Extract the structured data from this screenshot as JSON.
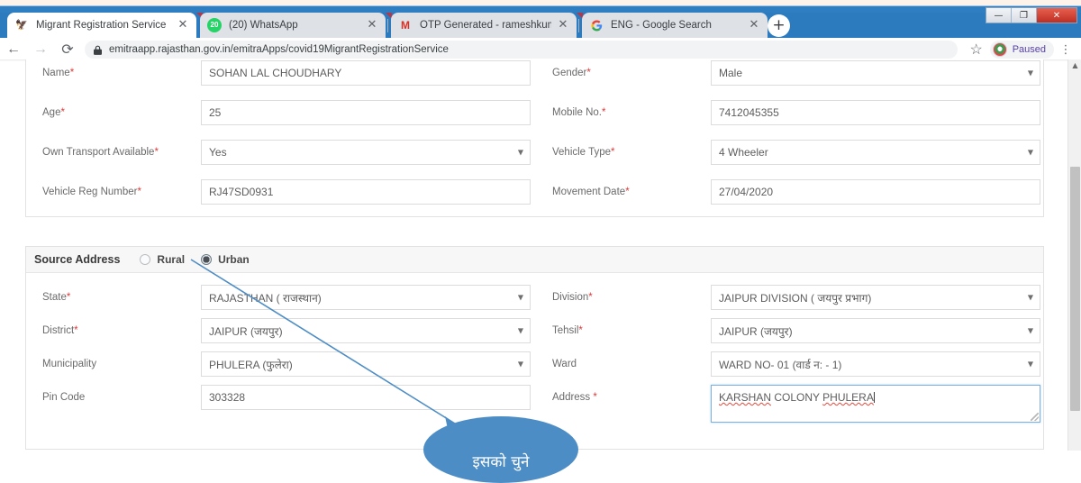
{
  "window": {
    "controls": [
      {
        "name": "minimize",
        "glyph": "—"
      },
      {
        "name": "maximize",
        "glyph": "❐"
      },
      {
        "name": "close",
        "glyph": "✕"
      }
    ]
  },
  "browser": {
    "tabs": [
      {
        "title": "Migrant Registration Service",
        "favicon": "site-favicon",
        "favicon_glyph": "🦅",
        "active": true,
        "close_glyph": "✕"
      },
      {
        "title": "(20) WhatsApp",
        "favicon": "whatsapp-favicon",
        "favicon_glyph": "20",
        "active": false,
        "close_glyph": "✕"
      },
      {
        "title": "OTP Generated - rameshkumawa",
        "favicon": "gmail-favicon",
        "favicon_glyph": "M",
        "active": false,
        "close_glyph": "✕"
      },
      {
        "title": "ENG - Google Search",
        "favicon": "google-favicon",
        "favicon_glyph": "G",
        "active": false,
        "close_glyph": "✕"
      }
    ],
    "new_tab_glyph": "+",
    "nav": {
      "back_glyph": "←",
      "forward_glyph": "→",
      "reload_glyph": "⟳"
    },
    "omnibox": {
      "url": "emitraapp.rajasthan.gov.in/emitraApps/covid19MigrantRegistrationService",
      "lock_icon": "lock-icon"
    },
    "bookmark_glyph": "☆",
    "profile": {
      "label": "Paused"
    },
    "menu_glyph": "⋮"
  },
  "page": {
    "personal_panel": {
      "rows": [
        {
          "left": {
            "label": "Name",
            "required": true,
            "type": "text",
            "value": "SOHAN LAL CHOUDHARY"
          },
          "right": {
            "label": "Gender",
            "required": true,
            "type": "select",
            "value": "Male"
          }
        },
        {
          "left": {
            "label": "Age",
            "required": true,
            "type": "text",
            "value": "25"
          },
          "right": {
            "label": "Mobile No.",
            "required": true,
            "type": "text",
            "value": "7412045355"
          }
        },
        {
          "left": {
            "label": "Own Transport Available",
            "required": true,
            "type": "select",
            "value": "Yes"
          },
          "right": {
            "label": "Vehicle Type",
            "required": true,
            "type": "select",
            "value": "4 Wheeler"
          }
        },
        {
          "left": {
            "label": "Vehicle Reg Number",
            "required": true,
            "type": "text",
            "value": "RJ47SD0931"
          },
          "right": {
            "label": "Movement Date",
            "required": true,
            "type": "text",
            "value": "27/04/2020"
          }
        }
      ]
    },
    "source_panel": {
      "title": "Source Address",
      "radios": [
        {
          "label": "Rural",
          "checked": false
        },
        {
          "label": "Urban",
          "checked": true
        }
      ],
      "rows": [
        {
          "left": {
            "label": "State",
            "required": true,
            "type": "select",
            "value": "RAJASTHAN ( राजस्थान)"
          },
          "right": {
            "label": "Division",
            "required": true,
            "type": "select",
            "value": "JAIPUR DIVISION ( जयपुर प्रभाग)"
          }
        },
        {
          "left": {
            "label": "District",
            "required": true,
            "type": "select",
            "value": "JAIPUR (जयपुर)"
          },
          "right": {
            "label": "Tehsil",
            "required": true,
            "type": "select",
            "value": "JAIPUR (जयपुर)"
          }
        },
        {
          "left": {
            "label": "Municipality",
            "required": false,
            "type": "select",
            "value": "PHULERA (फुलेरा)"
          },
          "right": {
            "label": "Ward",
            "required": false,
            "type": "select",
            "value": "WARD NO- 01 (वार्ड न: - 1)"
          }
        },
        {
          "left": {
            "label": "Pin Code",
            "required": false,
            "type": "text",
            "value": "303328"
          },
          "right": {
            "label": "Address ",
            "required": true,
            "type": "textarea",
            "value": "KARSHAN COLONY PHULERA",
            "spell_words": [
              "KARSHAN",
              "PHULERA"
            ],
            "plain_word": "COLONY"
          }
        }
      ]
    }
  },
  "annotation": {
    "callout_text": "इसको चुने",
    "callout_color": "#4d8dc6",
    "arrow_color": "#4d8dc6"
  },
  "scrollbar": {
    "up_arrow_glyph": "▲"
  }
}
